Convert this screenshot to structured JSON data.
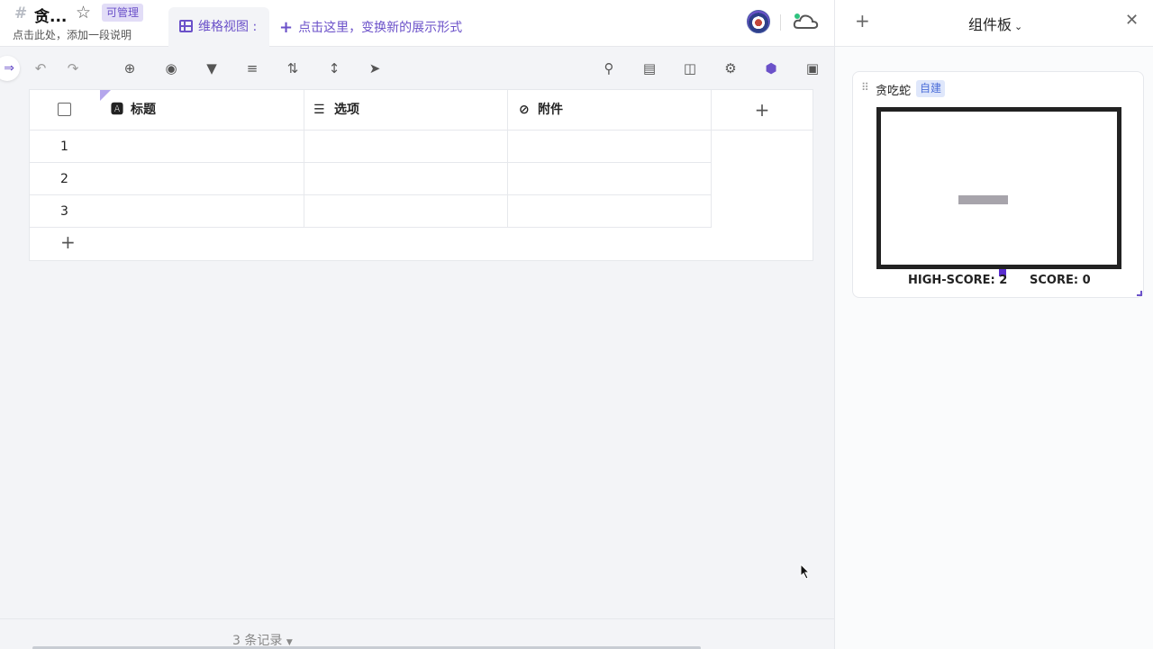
{
  "header": {
    "doc_title": "贪...",
    "permission": "可管理",
    "description": "点击此处，添加一段说明",
    "view_tab": "维格视图 :",
    "add_view": "点击这里，变换新的展示形式"
  },
  "table": {
    "columns": [
      {
        "icon": "text-field-icon",
        "label": "标题"
      },
      {
        "icon": "options-field-icon",
        "label": "选项"
      },
      {
        "icon": "attachment-field-icon",
        "label": "附件"
      }
    ],
    "rows": [
      "1",
      "2",
      "3"
    ]
  },
  "footer": {
    "record_count": "3 条记录"
  },
  "panel": {
    "title": "组件板",
    "widget": {
      "name": "贪吃蛇",
      "tag": "自建",
      "high_score_label": "HIGH-SCORE: 2",
      "score_label": "SCORE: 0",
      "high_score": 2,
      "score": 0
    }
  },
  "colors": {
    "accent": "#6b51c9",
    "snake": "#a7a4ab",
    "food": "#5a2ecf"
  }
}
